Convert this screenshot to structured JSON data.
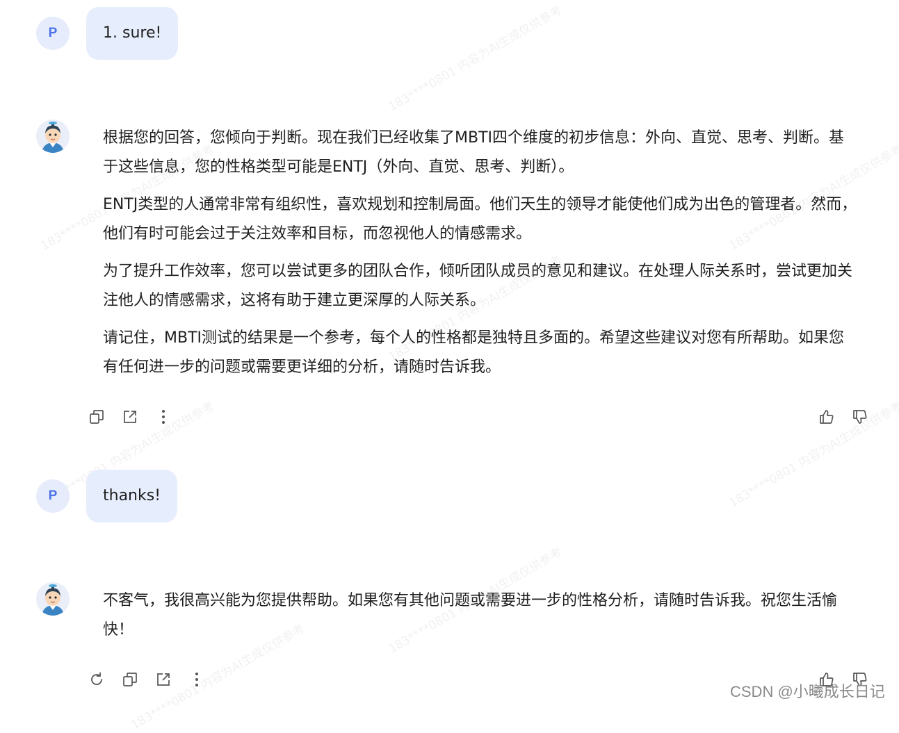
{
  "conversation": {
    "messages": [
      {
        "role": "user",
        "avatar_letter": "P",
        "text": "1. sure!"
      },
      {
        "role": "assistant",
        "paragraphs": [
          "根据您的回答，您倾向于判断。现在我们已经收集了MBTI四个维度的初步信息：外向、直觉、思考、判断。基于这些信息，您的性格类型可能是ENTJ（外向、直觉、思考、判断）。",
          "ENTJ类型的人通常非常有组织性，喜欢规划和控制局面。他们天生的领导才能使他们成为出色的管理者。然而，他们有时可能会过于关注效率和目标，而忽视他人的情感需求。",
          "为了提升工作效率，您可以尝试更多的团队合作，倾听团队成员的意见和建议。在处理人际关系时，尝试更加关注他人的情感需求，这将有助于建立更深厚的人际关系。",
          "请记住，MBTI测试的结果是一个参考，每个人的性格都是独特且多面的。希望这些建议对您有所帮助。如果您有任何进一步的问题或需要更详细的分析，请随时告诉我。"
        ]
      },
      {
        "role": "user",
        "avatar_letter": "P",
        "text": "thanks!"
      },
      {
        "role": "assistant",
        "paragraphs": [
          "不客气，我很高兴能为您提供帮助。如果您有其他问题或需要进一步的性格分析，请随时告诉我。祝您生活愉快！"
        ]
      }
    ]
  },
  "actions": {
    "first_reply": [
      "copy-icon",
      "share-icon",
      "more-icon",
      "thumbs-up-icon",
      "thumbs-down-icon"
    ],
    "last_reply": [
      "regenerate-icon",
      "copy-icon",
      "share-icon",
      "more-icon",
      "thumbs-up-icon",
      "thumbs-down-icon"
    ]
  },
  "watermark": {
    "text": "183****0801 内容为AI生成仅供参考"
  },
  "credit": {
    "text": "CSDN @小曦成长日记"
  },
  "colors": {
    "user_bubble": "#e6edfc",
    "user_avatar_bg": "#e6ecfb",
    "user_avatar_letter": "#4c72e8",
    "icon": "#555555"
  }
}
